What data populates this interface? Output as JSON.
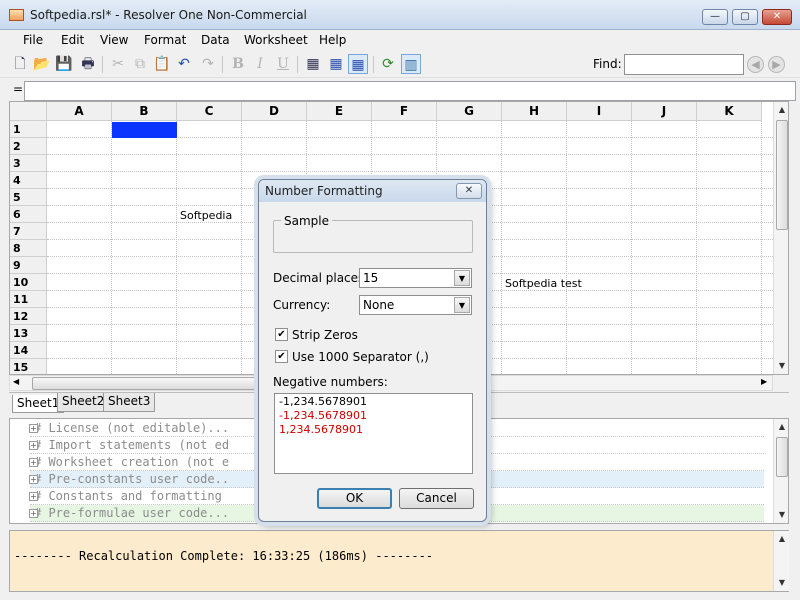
{
  "window": {
    "title": "Softpedia.rsl* - Resolver One Non-Commercial",
    "min_glyph": "—",
    "max_glyph": "▢",
    "close_glyph": "✕"
  },
  "menu": [
    "File",
    "Edit",
    "View",
    "Format",
    "Data",
    "Worksheet",
    "Help"
  ],
  "find": {
    "label": "Find:",
    "value": ""
  },
  "formula": {
    "eq": "=",
    "value": ""
  },
  "grid": {
    "columns": [
      "A",
      "B",
      "C",
      "D",
      "E",
      "F",
      "G",
      "H",
      "I",
      "J",
      "K"
    ],
    "rows": [
      "1",
      "2",
      "3",
      "4",
      "5",
      "6",
      "7",
      "8",
      "9",
      "10",
      "11",
      "12",
      "13",
      "14",
      "15"
    ],
    "cells": {
      "C6": "Softpedia",
      "H10": "Softpedia test"
    },
    "selected": "B1"
  },
  "sheet_tabs": [
    "Sheet1",
    "Sheet2",
    "Sheet3"
  ],
  "active_sheet": "Sheet1",
  "code_sections": [
    "# License (not editable)...",
    "# Import statements (not ed",
    "# Worksheet creation (not e",
    "# Pre-constants user code..",
    "# Constants and formatting",
    "# Pre-formulae user code..."
  ],
  "output": "-------- Recalculation Complete: 16:33:25 (186ms) --------",
  "dialog": {
    "title": "Number Formatting",
    "close_glyph": "✕",
    "sample_label": "Sample",
    "decimal_label": "Decimal places:",
    "decimal_value": "15",
    "currency_label": "Currency:",
    "currency_value": "None",
    "strip_zeros_label": "Strip Zeros",
    "strip_zeros_checked": true,
    "separator_label": "Use 1000 Separator (,)",
    "separator_checked": true,
    "negative_label": "Negative numbers:",
    "negative_options": [
      "-1,234.5678901",
      "-1,234.5678901",
      "1,234.5678901"
    ],
    "negative_colors": [
      "#000000",
      "#cc0000",
      "#cc0000"
    ],
    "ok_label": "OK",
    "cancel_label": "Cancel"
  }
}
